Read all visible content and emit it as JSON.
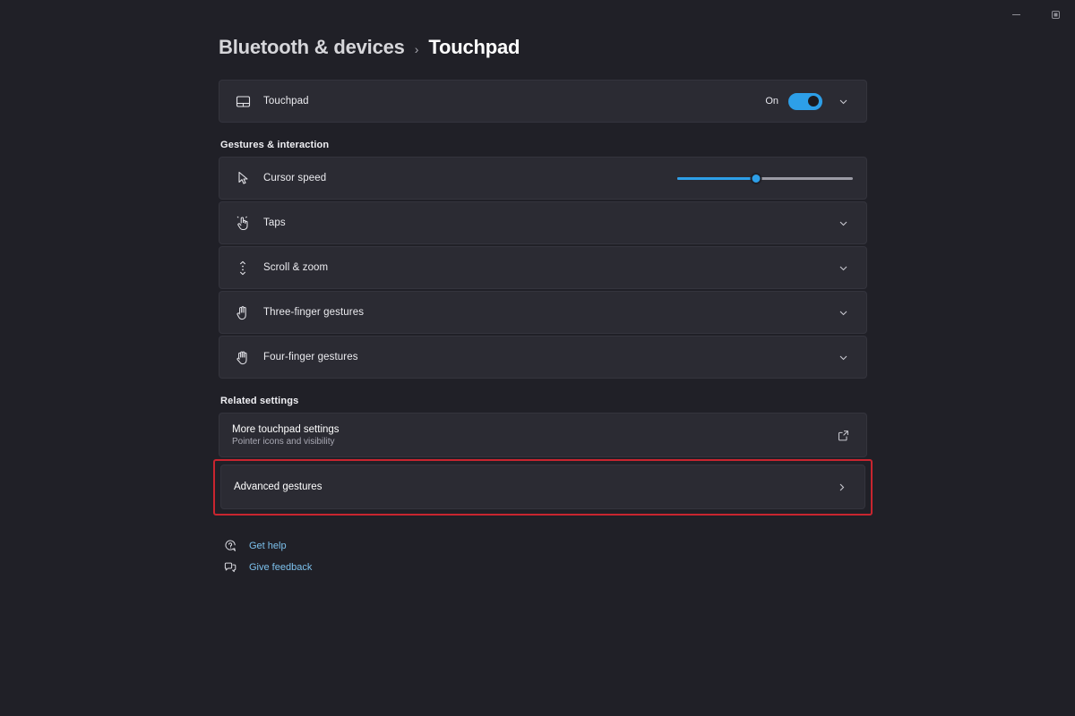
{
  "window": {
    "minimize_label": "Minimize",
    "restore_label": "Restore"
  },
  "breadcrumb": {
    "parent": "Bluetooth & devices",
    "separator": "›",
    "current": "Touchpad"
  },
  "touchpad_row": {
    "label": "Touchpad",
    "toggle_state": "On",
    "toggle_on": true,
    "icon": "touchpad-icon"
  },
  "sections": [
    {
      "title": "Gestures & interaction",
      "rows": [
        {
          "label": "Cursor speed",
          "icon": "cursor-icon",
          "control": "slider",
          "slider_percent": 45
        },
        {
          "label": "Taps",
          "icon": "tap-hand-icon",
          "control": "chevron-down"
        },
        {
          "label": "Scroll & zoom",
          "icon": "scroll-arrows-icon",
          "control": "chevron-down"
        },
        {
          "label": "Three-finger gestures",
          "icon": "three-finger-hand-icon",
          "control": "chevron-down"
        },
        {
          "label": "Four-finger gestures",
          "icon": "four-finger-hand-icon",
          "control": "chevron-down"
        }
      ]
    },
    {
      "title": "Related settings",
      "rows": [
        {
          "label": "More touchpad settings",
          "sublabel": "Pointer icons and visibility",
          "control": "external-link"
        },
        {
          "label": "Advanced gestures",
          "control": "chevron-right",
          "highlighted": true
        }
      ]
    }
  ],
  "footer_links": [
    {
      "label": "Get help",
      "icon": "help-icon"
    },
    {
      "label": "Give feedback",
      "icon": "feedback-icon"
    }
  ],
  "colors": {
    "background": "#202027",
    "card": "#2b2b33",
    "accent": "#2d9fe8",
    "link": "#7cc0ec",
    "highlight_border": "#c8252f"
  }
}
